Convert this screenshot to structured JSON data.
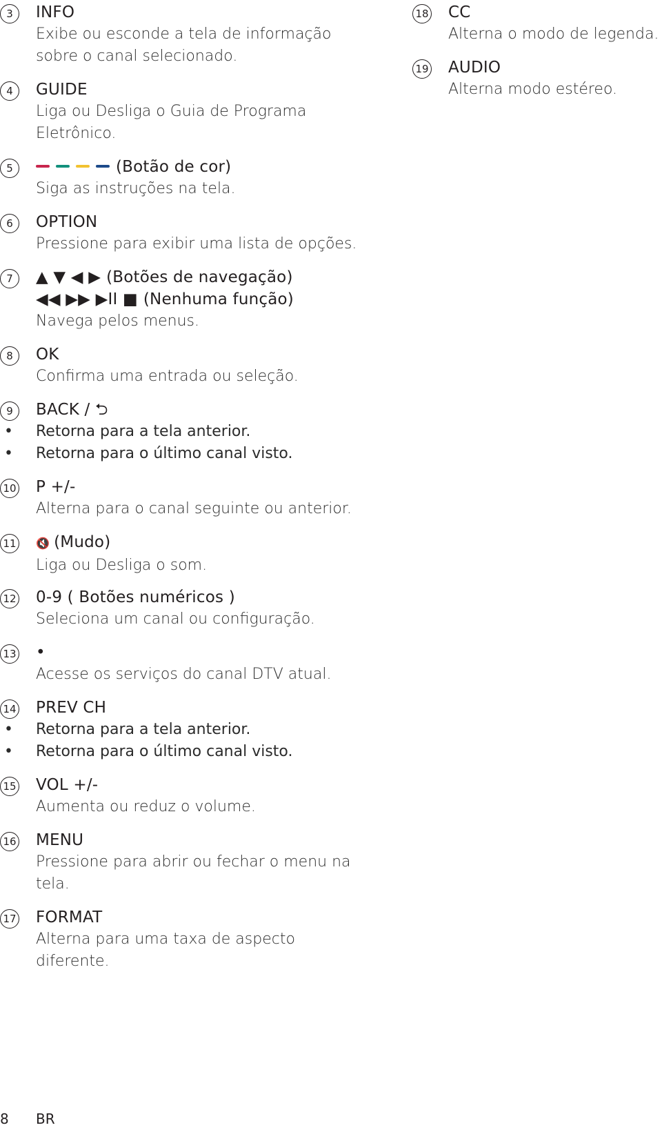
{
  "left_items": [
    {
      "num": "3",
      "title": "INFO",
      "desc": [
        "Exibe ou esconde a tela de informação",
        "sobre o canal selecionado."
      ]
    },
    {
      "num": "4",
      "title": "GUIDE",
      "desc": [
        "Liga ou Desliga o Guia de Programa",
        "Eletrônico."
      ]
    },
    {
      "num": "5",
      "title": "(Botão de cor)",
      "desc": [
        "Siga as instruções na tela."
      ],
      "colors": [
        "#c8264d",
        "#12907c",
        "#f2c230",
        "#1c4a8a"
      ]
    },
    {
      "num": "6",
      "title": "OPTION",
      "desc": [
        "Pressione para exibir uma lista de opções."
      ]
    },
    {
      "num": "7",
      "glyphs1": "▲ ▼ ◀ ▶",
      "title": "(Botões de navegação)",
      "glyphs2": "◀◀ ▶▶ ▶II ■",
      "title2": "(Nenhuma função)",
      "desc": [
        "Navega pelos menus."
      ]
    },
    {
      "num": "8",
      "title": "OK",
      "desc": [
        "Confirma uma entrada ou seleção."
      ]
    },
    {
      "num": "9",
      "title": "BACK / ⮌",
      "bullets": [
        "Retorna para a tela anterior.",
        "Retorna para o último canal visto."
      ]
    },
    {
      "num": "10",
      "title": "P +/-",
      "desc": [
        "Alterna para o canal seguinte ou anterior."
      ]
    },
    {
      "num": "11",
      "glyph": "🔇",
      "title": "(Mudo)",
      "desc": [
        "Liga ou Desliga o som."
      ]
    },
    {
      "num": "12",
      "title": "0-9 ( Botões numéricos )",
      "desc": [
        "Seleciona um canal ou configuração."
      ]
    },
    {
      "num": "13",
      "title": "•",
      "desc": [
        "Acesse os serviços do canal DTV atual."
      ]
    },
    {
      "num": "14",
      "title": "PREV CH",
      "bullets": [
        "Retorna para a tela anterior.",
        "Retorna para o último canal visto."
      ]
    },
    {
      "num": "15",
      "title": "VOL +/-",
      "desc": [
        "Aumenta ou reduz o volume."
      ]
    },
    {
      "num": "16",
      "title": "MENU",
      "desc": [
        "Pressione para abrir ou fechar o menu na",
        "tela."
      ]
    },
    {
      "num": "17",
      "title": "FORMAT",
      "desc": [
        "Alterna para uma taxa de aspecto",
        "diferente."
      ]
    }
  ],
  "right_items": [
    {
      "num": "18",
      "title": "CC",
      "desc": [
        "Alterna o modo de legenda."
      ]
    },
    {
      "num": "19",
      "title": "AUDIO",
      "desc": [
        "Alterna modo estéreo."
      ]
    }
  ],
  "footer": {
    "page": "8",
    "lang": "BR"
  }
}
